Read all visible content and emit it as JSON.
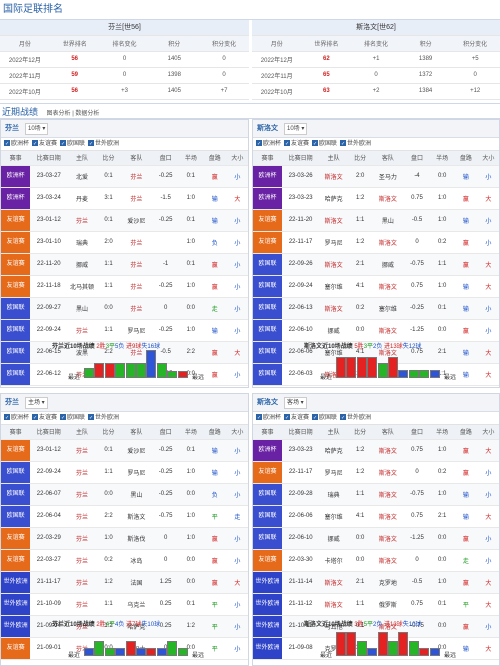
{
  "title": "国际足联排名",
  "ranking": {
    "headers": [
      "月份",
      "世界排名",
      "排名变化",
      "积分",
      "积分变化"
    ],
    "left": {
      "team": "芬兰[世56]",
      "rows": [
        [
          "2022年12月",
          "56",
          "0",
          "1405",
          "0"
        ],
        [
          "2022年11月",
          "59",
          "0",
          "1398",
          "0"
        ],
        [
          "2022年10月",
          "56",
          "+3",
          "1405",
          "+7"
        ]
      ]
    },
    "right": {
      "team": "斯洛文[世62]",
      "rows": [
        [
          "2022年12月",
          "62",
          "+1",
          "1389",
          "+5"
        ],
        [
          "2022年11月",
          "65",
          "0",
          "1372",
          "0"
        ],
        [
          "2022年10月",
          "63",
          "+2",
          "1384",
          "+12"
        ]
      ]
    }
  },
  "recent": {
    "title": "近期战绩",
    "tabs": "图表分析 | 数据分析"
  },
  "match_headers": [
    "赛事",
    "比赛日期",
    "主队",
    "比分",
    "客队",
    "盘口",
    "半场",
    "盘路",
    "大小"
  ],
  "filters": [
    "欧洲杯",
    "友谊赛",
    "欧国联",
    "世外欧洲"
  ],
  "filters_dropdown": {
    "label": "10场",
    "a": "主场",
    "b": "客场"
  },
  "panels": [
    {
      "team": "芬兰",
      "select": "10场",
      "filters": [
        "欧洲杯",
        "友谊赛",
        "欧国联",
        "世外欧洲"
      ],
      "rows": [
        [
          "欧洲杯",
          "23-03-27",
          "北爱",
          "0:1",
          "芬兰",
          "-0.25",
          "0:1",
          "赢",
          "小"
        ],
        [
          "欧洲杯",
          "23-03-24",
          "丹麦",
          "3:1",
          "芬兰",
          "-1.5",
          "1:0",
          "输",
          "大"
        ],
        [
          "友谊赛",
          "23-01-12",
          "芬兰",
          "0:1",
          "爱沙尼",
          "-0.25",
          "0:1",
          "输",
          "小"
        ],
        [
          "友谊赛",
          "23-01-10",
          "瑞典",
          "2:0",
          "芬兰",
          "",
          "1:0",
          "负",
          "小"
        ],
        [
          "友谊赛",
          "22-11-20",
          "挪威",
          "1:1",
          "芬兰",
          "-1",
          "0:1",
          "赢",
          "小"
        ],
        [
          "友谊赛",
          "22-11-18",
          "北马其顿",
          "1:1",
          "芬兰",
          "-0.25",
          "1:0",
          "赢",
          "小"
        ],
        [
          "欧国联",
          "22-09-27",
          "黑山",
          "0:0",
          "芬兰",
          "0",
          "0:0",
          "走",
          "小"
        ],
        [
          "欧国联",
          "22-09-24",
          "芬兰",
          "1:1",
          "罗马尼",
          "-0.25",
          "1:0",
          "输",
          "小"
        ],
        [
          "欧国联",
          "22-06-15",
          "波黑",
          "2:2",
          "芬兰",
          "-0.5",
          "2:2",
          "赢",
          "大"
        ],
        [
          "欧国联",
          "22-06-12",
          "芬兰",
          "1:0",
          "罗马尼",
          "-0.25",
          "0:0",
          "赢",
          "小"
        ]
      ],
      "summary": {
        "name": "芬兰近10场战绩",
        "w": "2胜",
        "d": "3平",
        "l": "5负",
        "gf": "进9球",
        "ga": "失16球"
      },
      "bars": [
        "d",
        "w",
        "w",
        "d",
        "d",
        "d",
        "l",
        "d",
        "d",
        "w"
      ],
      "heights": [
        0.35,
        0.55,
        0.55,
        0.55,
        0.55,
        0.55,
        1.0,
        0.55,
        0.25,
        0.25
      ],
      "axis": [
        "最近",
        "最远"
      ]
    },
    {
      "team": "斯洛文",
      "select": "10场",
      "filters": [
        "欧洲杯",
        "友谊赛",
        "欧国联",
        "世外欧洲"
      ],
      "rows": [
        [
          "欧洲杯",
          "23-03-26",
          "斯洛文",
          "2:0",
          "圣马力",
          "-4",
          "0:0",
          "输",
          "小"
        ],
        [
          "欧洲杯",
          "23-03-23",
          "哈萨克",
          "1:2",
          "斯洛文",
          "0.75",
          "1:0",
          "赢",
          "大"
        ],
        [
          "友谊赛",
          "22-11-20",
          "斯洛文",
          "1:1",
          "黑山",
          "-0.5",
          "1:0",
          "输",
          "小"
        ],
        [
          "友谊赛",
          "22-11-17",
          "罗马尼",
          "1:2",
          "斯洛文",
          "0",
          "0:2",
          "赢",
          "小"
        ],
        [
          "欧国联",
          "22-09-26",
          "斯洛文",
          "2:1",
          "挪威",
          "-0.75",
          "1:1",
          "赢",
          "大"
        ],
        [
          "欧国联",
          "22-09-24",
          "塞尔维",
          "4:1",
          "斯洛文",
          "0.75",
          "1:0",
          "输",
          "大"
        ],
        [
          "欧国联",
          "22-06-13",
          "斯洛文",
          "0:2",
          "塞尔维",
          "-0.25",
          "0:1",
          "输",
          "小"
        ],
        [
          "欧国联",
          "22-06-10",
          "挪威",
          "0:0",
          "斯洛文",
          "-1.25",
          "0:0",
          "赢",
          "小"
        ],
        [
          "欧国联",
          "22-06-06",
          "塞尔维",
          "4:1",
          "斯洛文",
          "0.75",
          "2:1",
          "输",
          "大"
        ],
        [
          "欧国联",
          "22-06-03",
          "斯洛文",
          "1:2",
          "瑞典",
          "-0.25",
          "1:1",
          "输",
          "大"
        ]
      ],
      "summary": {
        "name": "斯洛文近10场战绩",
        "w": "5胜",
        "d": "3平",
        "l": "2负",
        "gf": "进13球",
        "ga": "失12球"
      },
      "bars": [
        "w",
        "w",
        "w",
        "w",
        "d",
        "w",
        "l",
        "d",
        "d",
        "l"
      ],
      "heights": [
        0.75,
        0.75,
        0.75,
        0.75,
        0.55,
        0.75,
        0.3,
        0.3,
        0.3,
        0.3
      ],
      "axis": [
        "最近",
        "最远"
      ]
    },
    {
      "team": "芬兰",
      "select": "主场",
      "filters": [
        "欧洲杯",
        "友谊赛",
        "欧国联",
        "世外欧洲"
      ],
      "rows": [
        [
          "友谊赛",
          "23-01-12",
          "芬兰",
          "0:1",
          "爱沙尼",
          "-0.25",
          "0:1",
          "输",
          "小"
        ],
        [
          "欧国联",
          "22-09-24",
          "芬兰",
          "1:1",
          "罗马尼",
          "-0.25",
          "1:0",
          "输",
          "小"
        ],
        [
          "欧国联",
          "22-06-07",
          "芬兰",
          "0:0",
          "黑山",
          "-0.25",
          "0:0",
          "负",
          "小"
        ],
        [
          "欧国联",
          "22-06-04",
          "芬兰",
          "2:2",
          "斯洛文",
          "-0.75",
          "1:0",
          "平",
          "走"
        ],
        [
          "友谊赛",
          "22-03-29",
          "芬兰",
          "1:0",
          "斯洛伐",
          "0",
          "1:0",
          "赢",
          "小"
        ],
        [
          "友谊赛",
          "22-03-27",
          "芬兰",
          "0:2",
          "冰岛",
          "0",
          "0:0",
          "赢",
          "小"
        ],
        [
          "世外欧洲",
          "21-11-17",
          "芬兰",
          "1:2",
          "法国",
          "1.25",
          "0:0",
          "赢",
          "大"
        ],
        [
          "世外欧洲",
          "21-10-09",
          "芬兰",
          "1:1",
          "乌克兰",
          "0.25",
          "0:1",
          "平",
          "小"
        ],
        [
          "世外欧洲",
          "21-09-04",
          "芬兰",
          "1:2",
          "哈萨克",
          "0.25",
          "1:2",
          "平",
          "小"
        ],
        [
          "友谊赛",
          "21-09-01",
          "芬兰",
          "0:0",
          "威尔士",
          "0",
          "0:0",
          "平",
          "小"
        ]
      ],
      "summary": {
        "name": "芬兰近10场战绩",
        "w": "2胜",
        "d": "4平",
        "l": "4负",
        "gf": "进7球",
        "ga": "失10球"
      },
      "bars": [
        "l",
        "d",
        "d",
        "l",
        "w",
        "l",
        "w",
        "l",
        "d",
        "d"
      ],
      "heights": [
        0.3,
        0.55,
        0.3,
        0.3,
        0.55,
        0.3,
        0.3,
        0.3,
        0.55,
        0.3
      ],
      "axis": [
        "最近",
        "最远"
      ]
    },
    {
      "team": "斯洛文",
      "select": "客场",
      "filters": [
        "欧洲杯",
        "友谊赛",
        "欧国联",
        "世外欧洲"
      ],
      "rows": [
        [
          "欧洲杯",
          "23-03-23",
          "哈萨克",
          "1:2",
          "斯洛文",
          "0.75",
          "1:0",
          "赢",
          "大"
        ],
        [
          "友谊赛",
          "22-11-17",
          "罗马尼",
          "1:2",
          "斯洛文",
          "0",
          "0:2",
          "赢",
          "小"
        ],
        [
          "欧国联",
          "22-09-28",
          "瑞典",
          "1:1",
          "斯洛文",
          "-0.75",
          "1:0",
          "输",
          "小"
        ],
        [
          "欧国联",
          "22-06-06",
          "塞尔维",
          "4:1",
          "斯洛文",
          "0.75",
          "2:1",
          "输",
          "大"
        ],
        [
          "欧国联",
          "22-06-10",
          "挪威",
          "0:0",
          "斯洛文",
          "-1.25",
          "0:0",
          "赢",
          "小"
        ],
        [
          "友谊赛",
          "22-03-30",
          "卡塔尔",
          "0:0",
          "斯洛文",
          "0",
          "0:0",
          "走",
          "小"
        ],
        [
          "世外欧洲",
          "21-11-14",
          "斯洛文",
          "2:1",
          "克罗地",
          "-0.5",
          "1:0",
          "赢",
          "大"
        ],
        [
          "世外欧洲",
          "21-11-12",
          "斯洛文",
          "1:1",
          "俄罗斯",
          "0.75",
          "0:1",
          "平",
          "大"
        ],
        [
          "世外欧洲",
          "21-10-11",
          "马耳他",
          "0:1",
          "斯洛文",
          "-0.75",
          "0:0",
          "赢",
          "小"
        ],
        [
          "世外欧洲",
          "21-09-08",
          "克罗地",
          "3:0",
          "斯洛文",
          "1",
          "0:0",
          "输",
          "大"
        ]
      ],
      "summary": {
        "name": "斯洛文近10场战绩",
        "w": "3胜",
        "d": "5平",
        "l": "2负",
        "gf": "进13球",
        "ga": "失10球"
      },
      "bars": [
        "w",
        "w",
        "d",
        "l",
        "w",
        "d",
        "w",
        "d",
        "w",
        "l"
      ],
      "heights": [
        0.85,
        0.85,
        0.55,
        0.3,
        0.85,
        0.55,
        0.85,
        0.55,
        0.3,
        0.3
      ],
      "axis": [
        "最近",
        "最远"
      ]
    }
  ]
}
